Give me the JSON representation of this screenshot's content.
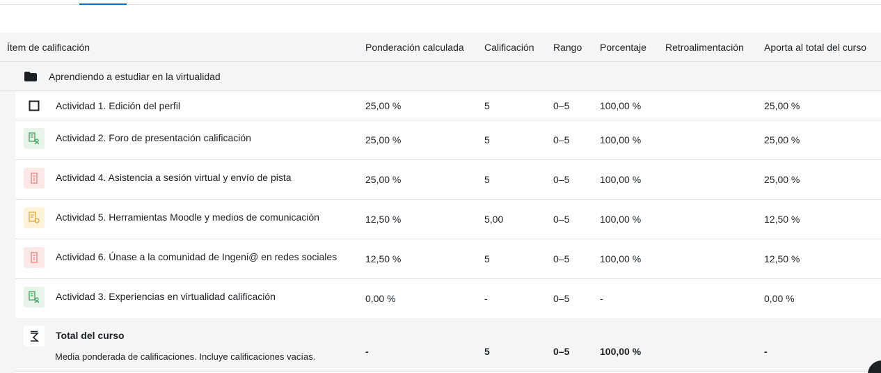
{
  "header": {
    "item": "Ítem de calificación",
    "weight": "Ponderación calculada",
    "grade": "Calificación",
    "range": "Rango",
    "percentage": "Porcentaje",
    "feedback": "Retroalimentación",
    "contribution": "Aporta al total del curso"
  },
  "category": {
    "name": "Aprendiendo a estudiar en la virtualidad",
    "icon": "folder-icon"
  },
  "rows": [
    {
      "name": "Actividad 1. Edición del perfil",
      "weight": "25,00 %",
      "grade": "5",
      "range": "0–5",
      "percentage": "100,00 %",
      "feedback": "",
      "contribution": "25,00 %",
      "icon": "checkbox-icon"
    },
    {
      "name": "Actividad 2. Foro de presentación calificación",
      "weight": "25,00 %",
      "grade": "5",
      "range": "0–5",
      "percentage": "100,00 %",
      "feedback": "",
      "contribution": "25,00 %",
      "icon": "forum-icon"
    },
    {
      "name": "Actividad 4. Asistencia a sesión virtual y envío de pista",
      "weight": "25,00 %",
      "grade": "5",
      "range": "0–5",
      "percentage": "100,00 %",
      "feedback": "",
      "contribution": "25,00 %",
      "icon": "assignment-icon"
    },
    {
      "name": "Actividad 5. Herramientas Moodle y medios de comunicación",
      "weight": "12,50 %",
      "grade": "5,00",
      "range": "0–5",
      "percentage": "100,00 %",
      "feedback": "",
      "contribution": "12,50 %",
      "icon": "quiz-icon"
    },
    {
      "name": "Actividad 6. Únase a la comunidad de Ingeni@ en redes sociales",
      "weight": "12,50 %",
      "grade": "5",
      "range": "0–5",
      "percentage": "100,00 %",
      "feedback": "",
      "contribution": "12,50 %",
      "icon": "assignment-icon"
    },
    {
      "name": "Actividad 3. Experiencias en virtualidad calificación",
      "weight": "0,00 %",
      "grade": "-",
      "range": "0–5",
      "percentage": "-",
      "feedback": "",
      "contribution": "0,00 %",
      "icon": "forum-icon"
    }
  ],
  "total": {
    "name": "Total del curso",
    "description": "Media ponderada de calificaciones. Incluye calificaciones vacías.",
    "weight": "-",
    "grade": "5",
    "range": "0–5",
    "percentage": "100,00 %",
    "contribution": "-",
    "icon": "sigma-icon"
  },
  "colors": {
    "accent": "#0f6cbf",
    "forum_icon": "#3fa55b",
    "assignment_icon": "#e8817a",
    "quiz_icon": "#e0a93b",
    "header_bg": "#f5f5f5"
  }
}
